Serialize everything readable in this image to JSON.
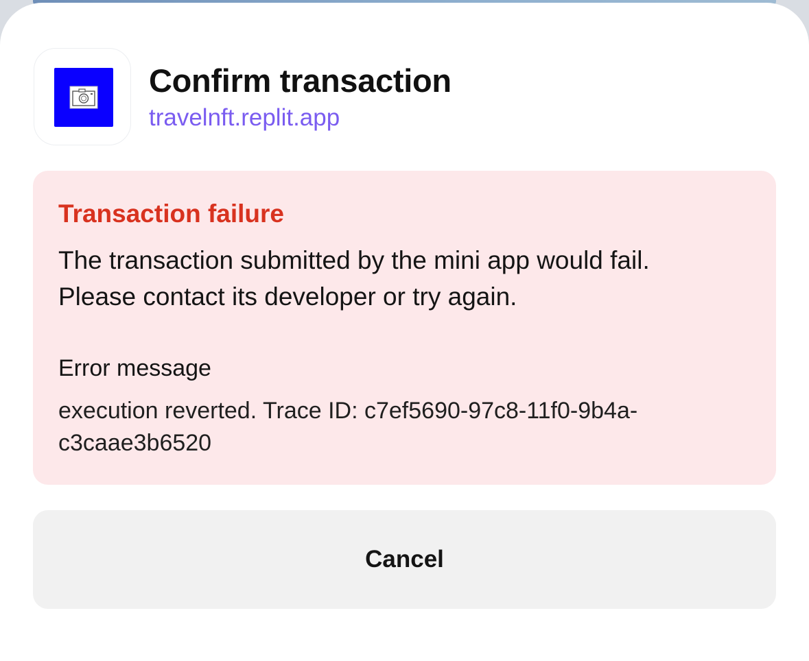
{
  "header": {
    "title": "Confirm transaction",
    "domain": "travelnft.replit.app",
    "app_icon": "camera-icon"
  },
  "error": {
    "title": "Transaction failure",
    "description_lines": [
      "The transaction submitted by the mini app would fail.",
      "Please contact its developer or try again."
    ],
    "message_label": "Error message",
    "message_lines": [
      "execution reverted. Trace ID: c7ef5690-97c8-11f0-9b4a-",
      "c3caae3b6520"
    ]
  },
  "actions": {
    "cancel_label": "Cancel"
  },
  "colors": {
    "accent_link": "#7a5cf0",
    "error_text": "#d8321f",
    "error_background": "#fde8ea",
    "app_icon_background": "#0a00ff",
    "button_background": "#f1f1f1"
  }
}
